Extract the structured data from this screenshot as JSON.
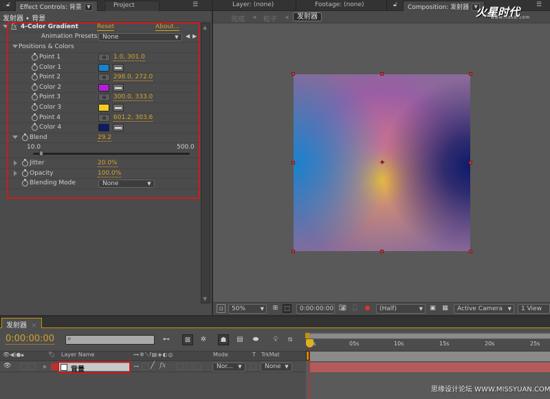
{
  "left_panel": {
    "tabs": [
      {
        "label": "Effect Controls: 背景",
        "active": true
      },
      {
        "label": "Project",
        "active": false
      }
    ],
    "breadcrumb": "发射器 • 背景",
    "effect": {
      "fx_icon": "fx",
      "name": "4-Color Gradient",
      "reset_label": "Reset",
      "about_label": "About...",
      "animation_presets_label": "Animation Presets:",
      "animation_presets_value": "None",
      "group_label": "Positions & Colors",
      "properties": [
        {
          "label": "Point 1",
          "type": "point",
          "value": "1.0, 301.0"
        },
        {
          "label": "Color 1",
          "type": "color",
          "color": "#1a82cc"
        },
        {
          "label": "Point 2",
          "type": "point",
          "value": "298.0, 272.0"
        },
        {
          "label": "Color 2",
          "type": "color",
          "color": "#b31fd6"
        },
        {
          "label": "Point 3",
          "type": "point",
          "value": "300.0, 333.0"
        },
        {
          "label": "Color 3",
          "type": "color",
          "color": "#f5cc22"
        },
        {
          "label": "Point 4",
          "type": "point",
          "value": "601.2, 303.6"
        },
        {
          "label": "Color 4",
          "type": "color",
          "color": "#0d1b6b"
        }
      ],
      "blend": {
        "label": "Blend",
        "value": "29.2",
        "min": "10.0",
        "max": "500.0",
        "slider_fraction": 0.04
      },
      "jitter": {
        "label": "Jitter",
        "value": "20.0%"
      },
      "opacity": {
        "label": "Opacity",
        "value": "100.0%"
      },
      "blending_mode": {
        "label": "Blending Mode",
        "value": "None"
      }
    }
  },
  "right_panel": {
    "tabs": [
      {
        "label": "Layer: (none)"
      },
      {
        "label": "Footage: (none)"
      },
      {
        "label": "Composition: 发射器",
        "active": true
      }
    ],
    "comp_nav": [
      "完成",
      "粒子",
      "发射器"
    ],
    "watermark_logo": "火星时代",
    "watermark_url": "www.hxsd.com",
    "viewer_toolbar": {
      "zoom": "50%",
      "timecode": "0:00:00:00",
      "resolution": "(Half)",
      "camera": "Active Camera",
      "views": "1 View"
    }
  },
  "timeline": {
    "tab_label": "发射器",
    "timecode": "0:00:00:00",
    "search_placeholder": "",
    "columns": {
      "layer_name": "Layer Name",
      "mode": "Mode",
      "t": "T",
      "trkmat": "TrkMat"
    },
    "layers": [
      {
        "name": "背景",
        "label_color": "#b83232",
        "mode": "Nor...",
        "trkmat": "None"
      }
    ],
    "ruler_labels": [
      "0s",
      "05s",
      "10s",
      "15s",
      "20s",
      "25s"
    ],
    "footer_watermark": "思缘设计论坛  WWW.MISSYUAN.COM"
  },
  "colors": {
    "accent": "#d6a22c",
    "highlight": "#d01a1a",
    "layer_bar": "#b55a5a"
  }
}
